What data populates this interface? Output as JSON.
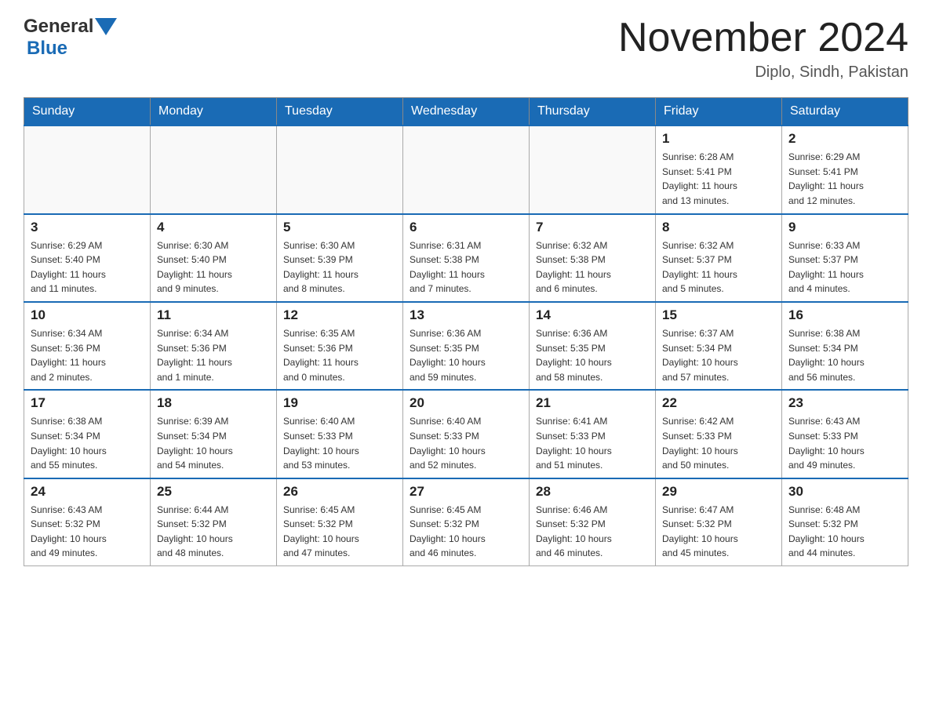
{
  "header": {
    "logo": {
      "text1": "General",
      "text2": "Blue"
    },
    "title": "November 2024",
    "location": "Diplo, Sindh, Pakistan"
  },
  "weekdays": [
    "Sunday",
    "Monday",
    "Tuesday",
    "Wednesday",
    "Thursday",
    "Friday",
    "Saturday"
  ],
  "weeks": [
    [
      {
        "day": "",
        "info": ""
      },
      {
        "day": "",
        "info": ""
      },
      {
        "day": "",
        "info": ""
      },
      {
        "day": "",
        "info": ""
      },
      {
        "day": "",
        "info": ""
      },
      {
        "day": "1",
        "info": "Sunrise: 6:28 AM\nSunset: 5:41 PM\nDaylight: 11 hours\nand 13 minutes."
      },
      {
        "day": "2",
        "info": "Sunrise: 6:29 AM\nSunset: 5:41 PM\nDaylight: 11 hours\nand 12 minutes."
      }
    ],
    [
      {
        "day": "3",
        "info": "Sunrise: 6:29 AM\nSunset: 5:40 PM\nDaylight: 11 hours\nand 11 minutes."
      },
      {
        "day": "4",
        "info": "Sunrise: 6:30 AM\nSunset: 5:40 PM\nDaylight: 11 hours\nand 9 minutes."
      },
      {
        "day": "5",
        "info": "Sunrise: 6:30 AM\nSunset: 5:39 PM\nDaylight: 11 hours\nand 8 minutes."
      },
      {
        "day": "6",
        "info": "Sunrise: 6:31 AM\nSunset: 5:38 PM\nDaylight: 11 hours\nand 7 minutes."
      },
      {
        "day": "7",
        "info": "Sunrise: 6:32 AM\nSunset: 5:38 PM\nDaylight: 11 hours\nand 6 minutes."
      },
      {
        "day": "8",
        "info": "Sunrise: 6:32 AM\nSunset: 5:37 PM\nDaylight: 11 hours\nand 5 minutes."
      },
      {
        "day": "9",
        "info": "Sunrise: 6:33 AM\nSunset: 5:37 PM\nDaylight: 11 hours\nand 4 minutes."
      }
    ],
    [
      {
        "day": "10",
        "info": "Sunrise: 6:34 AM\nSunset: 5:36 PM\nDaylight: 11 hours\nand 2 minutes."
      },
      {
        "day": "11",
        "info": "Sunrise: 6:34 AM\nSunset: 5:36 PM\nDaylight: 11 hours\nand 1 minute."
      },
      {
        "day": "12",
        "info": "Sunrise: 6:35 AM\nSunset: 5:36 PM\nDaylight: 11 hours\nand 0 minutes."
      },
      {
        "day": "13",
        "info": "Sunrise: 6:36 AM\nSunset: 5:35 PM\nDaylight: 10 hours\nand 59 minutes."
      },
      {
        "day": "14",
        "info": "Sunrise: 6:36 AM\nSunset: 5:35 PM\nDaylight: 10 hours\nand 58 minutes."
      },
      {
        "day": "15",
        "info": "Sunrise: 6:37 AM\nSunset: 5:34 PM\nDaylight: 10 hours\nand 57 minutes."
      },
      {
        "day": "16",
        "info": "Sunrise: 6:38 AM\nSunset: 5:34 PM\nDaylight: 10 hours\nand 56 minutes."
      }
    ],
    [
      {
        "day": "17",
        "info": "Sunrise: 6:38 AM\nSunset: 5:34 PM\nDaylight: 10 hours\nand 55 minutes."
      },
      {
        "day": "18",
        "info": "Sunrise: 6:39 AM\nSunset: 5:34 PM\nDaylight: 10 hours\nand 54 minutes."
      },
      {
        "day": "19",
        "info": "Sunrise: 6:40 AM\nSunset: 5:33 PM\nDaylight: 10 hours\nand 53 minutes."
      },
      {
        "day": "20",
        "info": "Sunrise: 6:40 AM\nSunset: 5:33 PM\nDaylight: 10 hours\nand 52 minutes."
      },
      {
        "day": "21",
        "info": "Sunrise: 6:41 AM\nSunset: 5:33 PM\nDaylight: 10 hours\nand 51 minutes."
      },
      {
        "day": "22",
        "info": "Sunrise: 6:42 AM\nSunset: 5:33 PM\nDaylight: 10 hours\nand 50 minutes."
      },
      {
        "day": "23",
        "info": "Sunrise: 6:43 AM\nSunset: 5:33 PM\nDaylight: 10 hours\nand 49 minutes."
      }
    ],
    [
      {
        "day": "24",
        "info": "Sunrise: 6:43 AM\nSunset: 5:32 PM\nDaylight: 10 hours\nand 49 minutes."
      },
      {
        "day": "25",
        "info": "Sunrise: 6:44 AM\nSunset: 5:32 PM\nDaylight: 10 hours\nand 48 minutes."
      },
      {
        "day": "26",
        "info": "Sunrise: 6:45 AM\nSunset: 5:32 PM\nDaylight: 10 hours\nand 47 minutes."
      },
      {
        "day": "27",
        "info": "Sunrise: 6:45 AM\nSunset: 5:32 PM\nDaylight: 10 hours\nand 46 minutes."
      },
      {
        "day": "28",
        "info": "Sunrise: 6:46 AM\nSunset: 5:32 PM\nDaylight: 10 hours\nand 46 minutes."
      },
      {
        "day": "29",
        "info": "Sunrise: 6:47 AM\nSunset: 5:32 PM\nDaylight: 10 hours\nand 45 minutes."
      },
      {
        "day": "30",
        "info": "Sunrise: 6:48 AM\nSunset: 5:32 PM\nDaylight: 10 hours\nand 44 minutes."
      }
    ]
  ]
}
